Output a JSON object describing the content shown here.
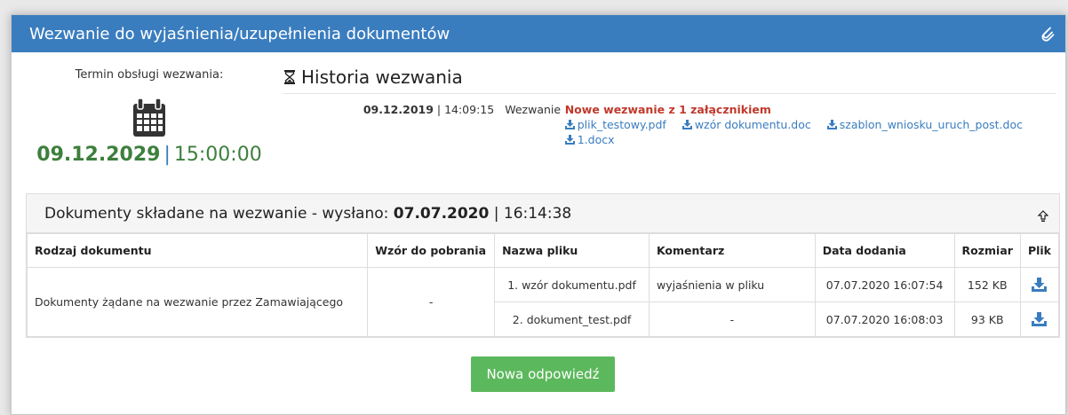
{
  "panel": {
    "title": "Wezwanie do wyjaśnienia/uzupełnienia dokumentów"
  },
  "deadline": {
    "label": "Termin obsługi wezwania:",
    "date": "09.12.2029",
    "separator": "|",
    "time": "15:00:00"
  },
  "history": {
    "title": "Historia wezwania",
    "entry": {
      "date": "09.12.2019",
      "time": " | 14:09:15",
      "type": "Wezwanie",
      "headline": "Nowe wezwanie z 1 załącznikiem",
      "files": [
        "plik_testowy.pdf",
        "wzór dokumentu.doc",
        "szablon_wniosku_uruch_post.doc",
        "1.docx"
      ]
    }
  },
  "documents": {
    "header_prefix": "Dokumenty składane na wezwanie - wysłano: ",
    "sent_date": "07.07.2020",
    "sent_time": " | 16:14:38",
    "columns": [
      "Rodzaj dokumentu",
      "Wzór do pobrania",
      "Nazwa pliku",
      "Komentarz",
      "Data dodania",
      "Rozmiar",
      "Plik"
    ],
    "group": {
      "type": "Dokumenty żądane na wezwanie przez Zamawiającego",
      "template": "-"
    },
    "rows": [
      {
        "file": "1. wzór dokumentu.pdf",
        "comment": "wyjaśnienia w pliku",
        "added": "07.07.2020 16:07:54",
        "size": "152 KB"
      },
      {
        "file": "2. dokument_test.pdf",
        "comment": "-",
        "added": "07.07.2020 16:08:03",
        "size": "93 KB"
      }
    ]
  },
  "actions": {
    "new_response": "Nowa odpowiedź"
  },
  "colors": {
    "header_blue": "#3a7dbf",
    "deadline_green": "#3d7f3d",
    "alert_red": "#c0392b",
    "button_green": "#5cb85c"
  }
}
